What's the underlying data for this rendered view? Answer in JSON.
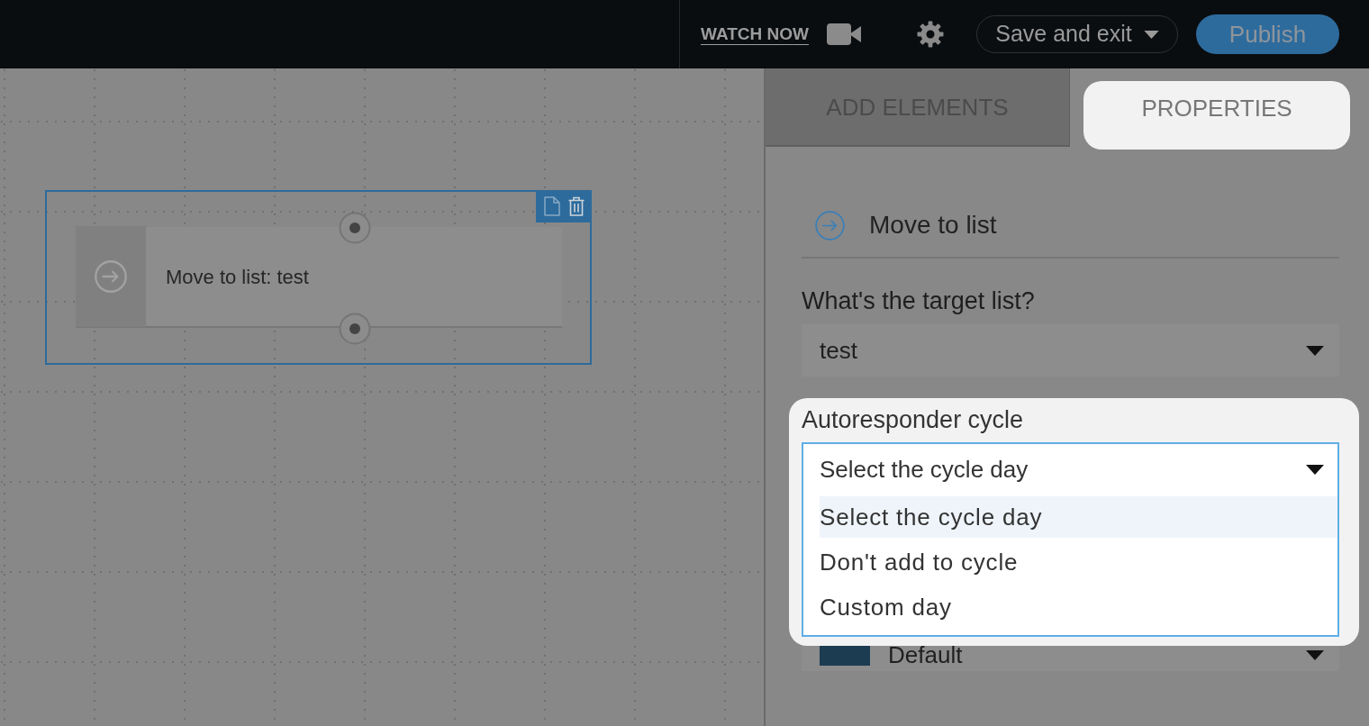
{
  "top_bar": {
    "watch_link": "WATCH NOW",
    "save_menu": "Save and exit",
    "publish_button": "Publish"
  },
  "canvas": {
    "nodes": [
      {
        "label": "Move to list: test",
        "selected": true
      }
    ]
  },
  "panel": {
    "tabs": [
      {
        "label": "ADD ELEMENTS",
        "selected": false
      },
      {
        "label": "PROPERTIES",
        "selected": true
      }
    ],
    "element_title": "Move to list",
    "fields": [
      {
        "kind": "select",
        "label": "What's the target list?",
        "value": "test",
        "expanded": false,
        "highlighted": false
      },
      {
        "kind": "select",
        "label": "Autoresponder cycle",
        "value": "Select the cycle day",
        "expanded": true,
        "highlighted": true,
        "options": [
          {
            "label": "Select the cycle day",
            "selected": true
          },
          {
            "label": "Don't add to cycle",
            "selected": false
          },
          {
            "label": "Custom day",
            "selected": false
          }
        ]
      },
      {
        "kind": "color_select",
        "value": "Default",
        "color": "#1c3c52"
      }
    ]
  }
}
